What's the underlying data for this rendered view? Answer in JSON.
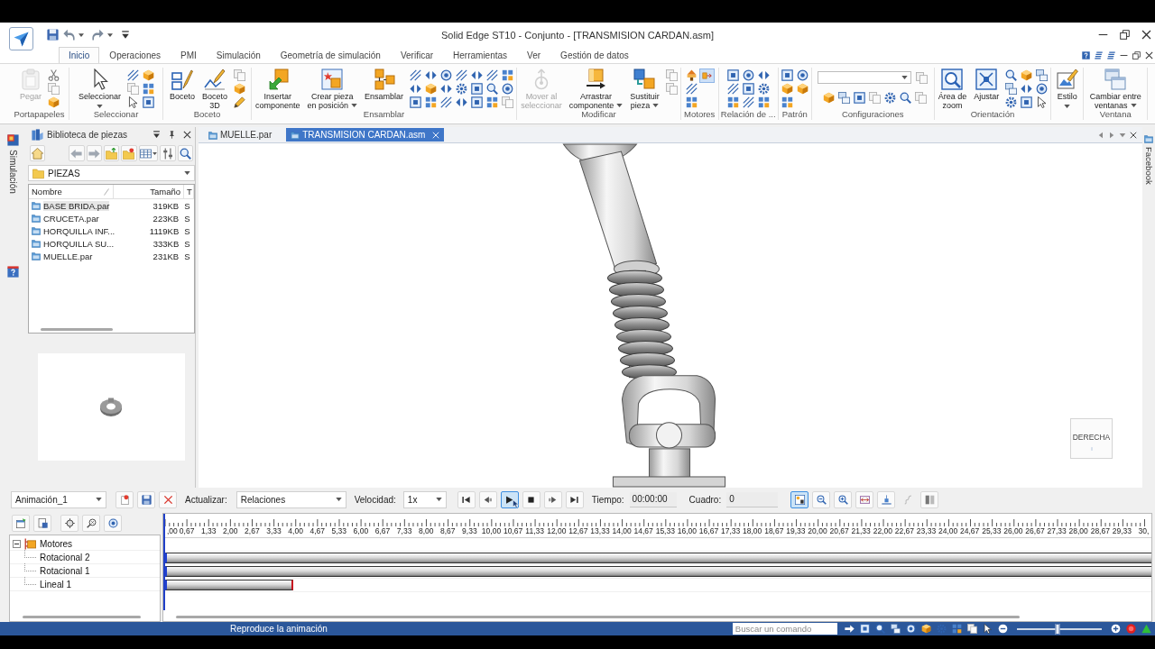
{
  "title_bar": {
    "title": "Solid Edge ST10 - Conjunto - [TRANSMISION CARDAN.asm]"
  },
  "ribbon_tabs": [
    {
      "label": "Inicio",
      "selected": true
    },
    {
      "label": "Operaciones",
      "selected": false
    },
    {
      "label": "PMI",
      "selected": false
    },
    {
      "label": "Simulación",
      "selected": false
    },
    {
      "label": "Geometría de simulación",
      "selected": false
    },
    {
      "label": "Verificar",
      "selected": false
    },
    {
      "label": "Herramientas",
      "selected": false
    },
    {
      "label": "Ver",
      "selected": false
    },
    {
      "label": "Gestión de datos",
      "selected": false
    }
  ],
  "ribbon_groups": [
    {
      "label": "Portapapeles",
      "buttons": [
        {
          "label": "Pegar",
          "disabled": true,
          "dropdown": false
        }
      ]
    },
    {
      "label": "Seleccionar",
      "buttons": [
        {
          "label": "Seleccionar",
          "disabled": false,
          "dropdown": true
        }
      ]
    },
    {
      "label": "Boceto",
      "buttons": [
        {
          "label": "Boceto",
          "disabled": false,
          "dropdown": false
        },
        {
          "label": "Boceto\n3D",
          "disabled": false,
          "dropdown": false
        }
      ]
    },
    {
      "label": "Ensamblar",
      "buttons": [
        {
          "label": "Insertar\ncomponente",
          "disabled": false,
          "dropdown": false
        },
        {
          "label": "Crear pieza\nen posición",
          "disabled": false,
          "dropdown": true
        },
        {
          "label": "Ensamblar",
          "disabled": false,
          "dropdown": false
        }
      ]
    },
    {
      "label": "Modificar",
      "buttons": [
        {
          "label": "Mover al\nseleccionar",
          "disabled": true,
          "dropdown": false
        },
        {
          "label": "Arrastrar\ncomponente",
          "disabled": false,
          "dropdown": true
        },
        {
          "label": "Sustituir\npieza",
          "disabled": false,
          "dropdown": true
        }
      ]
    },
    {
      "label": "Motores",
      "toggles": [
        {
          "selected": true
        }
      ]
    },
    {
      "label": "Relación de ..."
    },
    {
      "label": "Patrón"
    },
    {
      "label": "Configuraciones"
    },
    {
      "label": "Orientación",
      "buttons": [
        {
          "label": "Área de\nzoom",
          "disabled": false,
          "dropdown": false
        },
        {
          "label": "Ajustar",
          "disabled": false,
          "dropdown": false
        }
      ]
    },
    {
      "buttons": [
        {
          "label": "Estilo",
          "disabled": false,
          "dropdown": true
        }
      ]
    },
    {
      "label": "Ventana",
      "buttons": [
        {
          "label": "Cambiar entre\nventanas",
          "disabled": false,
          "dropdown": true
        }
      ]
    }
  ],
  "left_dock": {
    "tabs": [
      {
        "label": "Simulación"
      }
    ]
  },
  "library": {
    "title": "Biblioteca de piezas",
    "folder": "PIEZAS",
    "columns": [
      "Nombre",
      "Tamaño",
      "T"
    ],
    "rows": [
      {
        "name": "BASE BRIDA.par",
        "size": "319KB",
        "type": "S",
        "selected": true
      },
      {
        "name": "CRUCETA.par",
        "size": "223KB",
        "type": "S",
        "selected": false
      },
      {
        "name": "HORQUILLA INF...",
        "size": "1119KB",
        "type": "S",
        "selected": false
      },
      {
        "name": "HORQUILLA SU...",
        "size": "333KB",
        "type": "S",
        "selected": false
      },
      {
        "name": "MUELLE.par",
        "size": "231KB",
        "type": "S",
        "selected": false
      }
    ]
  },
  "document_tabs": [
    {
      "label": "MUELLE.par",
      "selected": false
    },
    {
      "label": "TRANSMISION CARDAN.asm",
      "selected": true
    }
  ],
  "view_cube": {
    "label": "DERECHA"
  },
  "right_dock": {
    "tabs": [
      {
        "label": "Facebook"
      }
    ]
  },
  "animation_bar": {
    "animation": "Animación_1",
    "update_label": "Actualizar:",
    "update_mode": "Relaciones",
    "speed_label": "Velocidad:",
    "speed": "1x",
    "transport": [
      {
        "selected": false
      },
      {
        "selected": false
      },
      {
        "selected": true
      },
      {
        "selected": false
      },
      {
        "selected": false
      },
      {
        "selected": false
      }
    ],
    "time_label": "Tiempo:",
    "time": "00:00:00",
    "frame_label": "Cuadro:",
    "frame": "0",
    "view_tools": [
      {
        "selected": true,
        "disabled": false
      },
      {
        "selected": false,
        "disabled": false
      },
      {
        "selected": false,
        "disabled": false
      },
      {
        "selected": false,
        "disabled": false
      },
      {
        "selected": false,
        "disabled": false
      },
      {
        "selected": false,
        "disabled": true
      },
      {
        "selected": false,
        "disabled": false
      }
    ]
  },
  "timeline": {
    "ruler_labels": [
      ",00",
      "0,67",
      "1,33",
      "2,00",
      "2,67",
      "3,33",
      "4,00",
      "4,67",
      "5,33",
      "6,00",
      "6,67",
      "7,33",
      "8,00",
      "8,67",
      "9,33",
      "10,00",
      "10,67",
      "11,33",
      "12,00",
      "12,67",
      "13,33",
      "14,00",
      "14,67",
      "15,33",
      "16,00",
      "16,67",
      "17,33",
      "18,00",
      "18,67",
      "19,33",
      "20,00",
      "20,67",
      "21,33",
      "22,00",
      "22,67",
      "23,33",
      "24,00",
      "24,67",
      "25,33",
      "26,00",
      "26,67",
      "27,33",
      "28,00",
      "28,67",
      "29,33",
      "30,"
    ],
    "playhead": {
      "level": 0
    },
    "tree": [
      {
        "label": "Motores",
        "expanded": true,
        "children": [
          {
            "label": "Rotacional 2",
            "level": 1
          },
          {
            "label": "Rotacional 1",
            "level": 1
          },
          {
            "label": "Lineal 1",
            "level": 0.13
          }
        ]
      }
    ]
  },
  "status_bar": {
    "message": "Reproduce la animación",
    "search": {
      "placeholder": "Buscar un comando"
    },
    "zoom_slider": {
      "level": 0.48
    }
  }
}
